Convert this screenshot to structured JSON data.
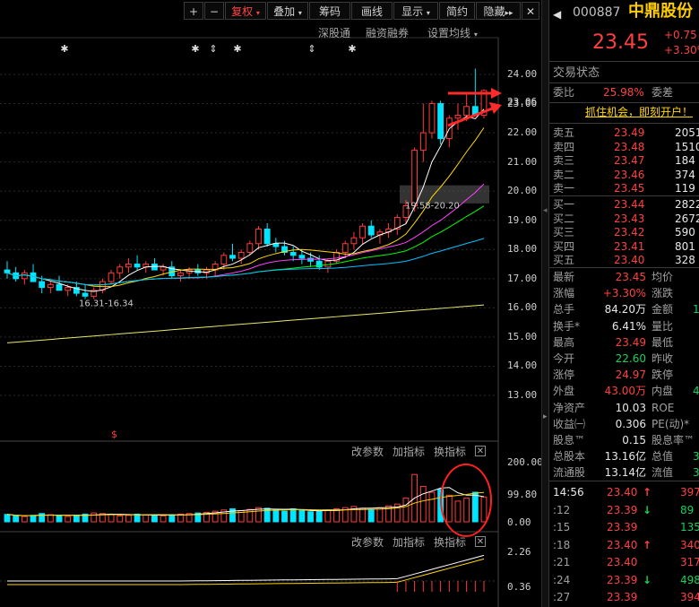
{
  "toolbar": {
    "items": [
      "+",
      "−",
      "复权",
      "叠加",
      "筹码",
      "画线",
      "显示",
      "简约",
      "隐藏"
    ],
    "fuquan": "复权",
    "diejia": "叠加",
    "chouma": "筹码",
    "huaxian": "画线",
    "xianshi": "显示",
    "jianyue": "简约",
    "yincang": "隐藏",
    "plus": "+",
    "minus": "−"
  },
  "chart_header": {
    "link1": "深股通",
    "link2": "融资融券",
    "link3": "设置均线"
  },
  "price_axis": [
    "24.00",
    "23.06",
    "23.00",
    "22.00",
    "21.00",
    "20.00",
    "19.00",
    "18.00",
    "17.00",
    "16.00",
    "15.00",
    "14.00",
    "13.00"
  ],
  "annotations": {
    "range_high": "19.58-20.20",
    "range_low": "16.31-16.34",
    "s_mark": "$"
  },
  "volume_panel": {
    "change_params": "改参数",
    "add_indicator": "加指标",
    "switch_indicator": "换指标",
    "axis": [
      "200.00",
      "99.80",
      "0.00"
    ]
  },
  "macd_panel": {
    "change_params": "改参数",
    "add_indicator": "加指标",
    "switch_indicator": "换指标",
    "axis": [
      "2.26",
      "0.36"
    ]
  },
  "colors": {
    "up": "#ff3b3b",
    "down": "#00e5ff",
    "ma5": "#ffffff",
    "ma10": "#ffd700",
    "ma20": "#ff40ff",
    "ma30": "#00ff00",
    "ma60": "#00c0ff",
    "ma250": "#e8e86a",
    "arrow": "#ff2a2a"
  },
  "chart_data": {
    "type": "candlestick",
    "candles": [
      [
        17.3,
        17.6,
        17.0,
        17.2
      ],
      [
        17.2,
        17.4,
        16.9,
        17.0
      ],
      [
        17.0,
        17.3,
        16.8,
        17.2
      ],
      [
        17.2,
        17.5,
        16.9,
        16.9
      ],
      [
        16.9,
        17.1,
        16.5,
        16.7
      ],
      [
        16.7,
        16.9,
        16.5,
        16.8
      ],
      [
        16.8,
        17.1,
        16.6,
        16.6
      ],
      [
        16.6,
        16.8,
        16.4,
        16.7
      ],
      [
        16.7,
        16.9,
        16.4,
        16.5
      ],
      [
        16.5,
        16.8,
        16.3,
        16.4
      ],
      [
        16.4,
        16.7,
        16.3,
        16.6
      ],
      [
        16.6,
        17.0,
        16.5,
        16.9
      ],
      [
        16.9,
        17.3,
        16.8,
        17.2
      ],
      [
        17.2,
        17.5,
        17.0,
        17.4
      ],
      [
        17.4,
        17.7,
        17.2,
        17.5
      ],
      [
        17.5,
        17.8,
        17.3,
        17.4
      ],
      [
        17.4,
        17.6,
        17.2,
        17.5
      ],
      [
        17.5,
        17.7,
        17.3,
        17.3
      ],
      [
        17.3,
        17.5,
        17.1,
        17.4
      ],
      [
        17.4,
        17.6,
        17.0,
        17.1
      ],
      [
        17.1,
        17.3,
        16.9,
        17.2
      ],
      [
        17.2,
        17.4,
        17.0,
        17.3
      ],
      [
        17.3,
        17.5,
        17.1,
        17.2
      ],
      [
        17.2,
        17.4,
        17.0,
        17.3
      ],
      [
        17.3,
        17.6,
        17.1,
        17.5
      ],
      [
        17.5,
        17.9,
        17.3,
        17.8
      ],
      [
        17.8,
        18.2,
        17.6,
        17.7
      ],
      [
        17.7,
        18.0,
        17.5,
        17.9
      ],
      [
        17.9,
        18.3,
        17.8,
        18.2
      ],
      [
        18.2,
        18.8,
        18.0,
        18.7
      ],
      [
        18.7,
        18.9,
        18.1,
        18.2
      ],
      [
        18.2,
        18.4,
        17.9,
        18.1
      ],
      [
        18.1,
        18.3,
        17.8,
        17.9
      ],
      [
        17.9,
        18.1,
        17.6,
        17.8
      ],
      [
        17.8,
        18.0,
        17.5,
        17.7
      ],
      [
        17.7,
        17.9,
        17.4,
        17.6
      ],
      [
        17.6,
        17.8,
        17.3,
        17.4
      ],
      [
        17.4,
        17.7,
        17.2,
        17.6
      ],
      [
        17.6,
        18.0,
        17.5,
        17.9
      ],
      [
        17.9,
        18.3,
        17.7,
        18.2
      ],
      [
        18.2,
        18.6,
        18.0,
        18.4
      ],
      [
        18.4,
        18.9,
        18.2,
        18.8
      ],
      [
        18.8,
        19.0,
        18.4,
        18.5
      ],
      [
        18.5,
        18.7,
        18.2,
        18.6
      ],
      [
        18.6,
        18.9,
        18.4,
        18.7
      ],
      [
        18.7,
        19.2,
        18.5,
        19.1
      ],
      [
        19.1,
        19.7,
        18.9,
        19.5
      ],
      [
        19.5,
        21.5,
        19.3,
        21.4
      ],
      [
        21.4,
        23.0,
        21.0,
        22.0
      ],
      [
        22.0,
        23.1,
        21.8,
        23.0
      ],
      [
        23.0,
        23.1,
        21.6,
        21.8
      ],
      [
        21.8,
        22.6,
        21.5,
        22.5
      ],
      [
        22.5,
        23.0,
        22.1,
        22.6
      ],
      [
        22.6,
        23.4,
        22.4,
        22.9
      ],
      [
        22.9,
        24.2,
        22.8,
        22.6
      ],
      [
        22.6,
        23.49,
        22.5,
        23.45
      ]
    ],
    "volume": [
      25,
      20,
      18,
      22,
      28,
      24,
      20,
      18,
      22,
      26,
      30,
      28,
      24,
      20,
      22,
      26,
      24,
      22,
      20,
      24,
      26,
      28,
      30,
      32,
      36,
      40,
      44,
      38,
      42,
      48,
      46,
      40,
      36,
      44,
      38,
      34,
      36,
      40,
      44,
      48,
      52,
      46,
      42,
      48,
      54,
      60,
      80,
      160,
      120,
      100,
      110,
      90,
      70,
      80,
      100,
      84
    ],
    "price_range": [
      12.8,
      24.6
    ],
    "volume_range": [
      0,
      200
    ],
    "markers": [
      "✱",
      "✱",
      "⇕",
      "✱",
      "⇕",
      "✱"
    ]
  },
  "side": {
    "code": "000887",
    "name": "中鼎股份",
    "price": "23.45",
    "change": "+0.75",
    "change_pct": "+3.30%",
    "status_label": "交易状态",
    "webi_label": "委比",
    "webi_value": "25.98%",
    "weicha_label": "委差",
    "ad_text": "抓住机会，即刻开户！",
    "asks": [
      {
        "label": "卖五",
        "price": "23.49",
        "vol": "2051"
      },
      {
        "label": "卖四",
        "price": "23.48",
        "vol": "1510"
      },
      {
        "label": "卖三",
        "price": "23.47",
        "vol": "184"
      },
      {
        "label": "卖二",
        "price": "23.46",
        "vol": "374"
      },
      {
        "label": "卖一",
        "price": "23.45",
        "vol": "119"
      }
    ],
    "bids": [
      {
        "label": "买一",
        "price": "23.44",
        "vol": "2822"
      },
      {
        "label": "买二",
        "price": "23.43",
        "vol": "2672"
      },
      {
        "label": "买三",
        "price": "23.42",
        "vol": "590"
      },
      {
        "label": "买四",
        "price": "23.41",
        "vol": "801"
      },
      {
        "label": "买五",
        "price": "23.40",
        "vol": "328"
      }
    ],
    "stats": [
      {
        "l1": "最新",
        "v1": "23.45",
        "c1": "red",
        "l2": "均价",
        "v2": ""
      },
      {
        "l1": "涨幅",
        "v1": "+3.30%",
        "c1": "red",
        "l2": "涨跌",
        "v2": ""
      },
      {
        "l1": "总手",
        "v1": "84.20万",
        "c1": "white",
        "l2": "金额",
        "v2": "1"
      },
      {
        "l1": "换手*",
        "v1": "6.41%",
        "c1": "white",
        "l2": "量比",
        "v2": ""
      },
      {
        "l1": "最高",
        "v1": "23.49",
        "c1": "red",
        "l2": "最低",
        "v2": ""
      },
      {
        "l1": "今开",
        "v1": "22.60",
        "c1": "green",
        "l2": "昨收",
        "v2": ""
      },
      {
        "l1": "涨停",
        "v1": "24.97",
        "c1": "red",
        "l2": "跌停",
        "v2": ""
      },
      {
        "l1": "外盘",
        "v1": "43.00万",
        "c1": "red",
        "l2": "内盘",
        "v2": "4"
      },
      {
        "l1": "净资产",
        "v1": "10.03",
        "c1": "white",
        "l2": "ROE",
        "v2": ""
      },
      {
        "l1": "收益㈠",
        "v1": "0.306",
        "c1": "white",
        "l2": "PE(动)*",
        "v2": ""
      },
      {
        "l1": "股息™",
        "v1": "0.15",
        "c1": "white",
        "l2": "股息率™",
        "v2": ""
      },
      {
        "l1": "总股本",
        "v1": "13.16亿",
        "c1": "white",
        "l2": "总值",
        "v2": "3"
      },
      {
        "l1": "流通股",
        "v1": "13.14亿",
        "c1": "white",
        "l2": "流值",
        "v2": "3"
      }
    ],
    "ticks": [
      {
        "time": "14:56",
        "price": "23.40",
        "arrow": "↑",
        "ac": "red",
        "vol": "397",
        "vc": "red"
      },
      {
        "time": ":12",
        "price": "23.39",
        "arrow": "↓",
        "ac": "green",
        "vol": "89",
        "vc": "green"
      },
      {
        "time": ":15",
        "price": "23.39",
        "arrow": "",
        "ac": "",
        "vol": "135",
        "vc": "green"
      },
      {
        "time": ":18",
        "price": "23.40",
        "arrow": "↑",
        "ac": "red",
        "vol": "340",
        "vc": "red"
      },
      {
        "time": ":21",
        "price": "23.40",
        "arrow": "",
        "ac": "",
        "vol": "317",
        "vc": "red"
      },
      {
        "time": ":24",
        "price": "23.39",
        "arrow": "↓",
        "ac": "green",
        "vol": "498",
        "vc": "green"
      },
      {
        "time": ":27",
        "price": "23.39",
        "arrow": "",
        "ac": "",
        "vol": "394",
        "vc": "red"
      }
    ]
  }
}
